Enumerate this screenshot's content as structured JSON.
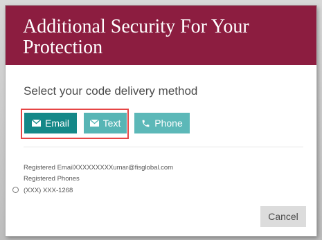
{
  "dialog": {
    "title": "Additional Security For Your Protection",
    "prompt": "Select your code delivery method"
  },
  "methods": {
    "email_label": "Email",
    "text_label": "Text",
    "phone_label": "Phone"
  },
  "registered": {
    "email_line": "Registered EmailXXXXXXXXXumar@fisglobal.com",
    "phones_label": "Registered Phones",
    "phone_number": "(XXX) XXX-1268"
  },
  "actions": {
    "cancel_label": "Cancel"
  },
  "colors": {
    "header": "#8c1d40",
    "email_button": "#148888",
    "text_button": "#57b5b5",
    "phone_button": "#5cb8b8",
    "highlight": "#e64545",
    "cancel_button": "#dcdcdc"
  },
  "icons": {
    "email": "envelope-icon",
    "text": "envelope-icon",
    "phone": "phone-icon"
  }
}
